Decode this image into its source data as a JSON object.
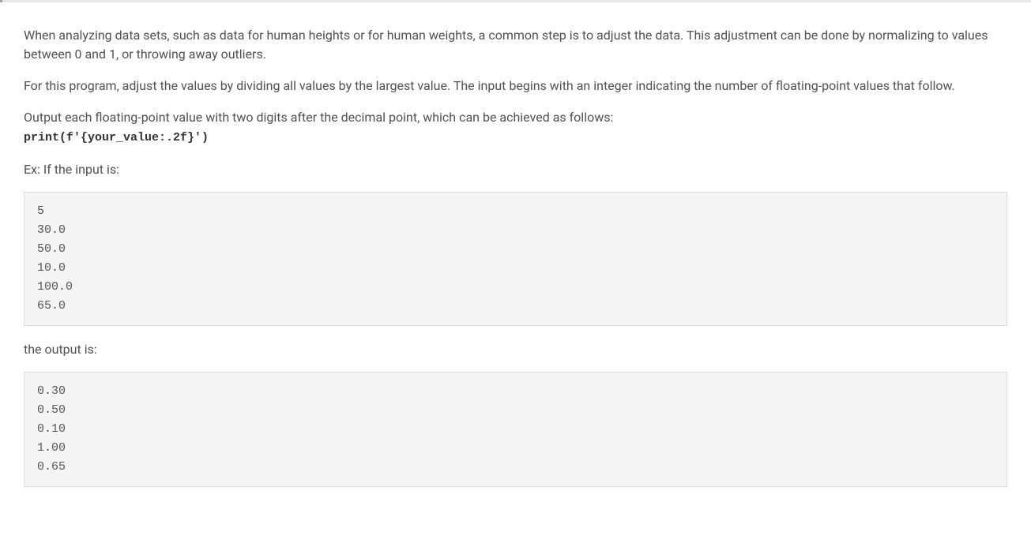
{
  "para1": "When analyzing data sets, such as data for human heights or for human weights, a common step is to adjust the data. This adjustment can be done by normalizing to values between 0 and 1, or throwing away outliers.",
  "para2": "For this program, adjust the values by dividing all values by the largest value. The input begins with an integer indicating the number of floating-point values that follow.",
  "para3_text": "Output each floating-point value with two digits after the decimal point, which can be achieved as follows:",
  "para3_code": "print(f'{your_value:.2f}')",
  "para4": "Ex: If the input is:",
  "input_block": "5\n30.0\n50.0\n10.0\n100.0\n65.0",
  "para5": "the output is:",
  "output_block": "0.30\n0.50\n0.10\n1.00\n0.65"
}
